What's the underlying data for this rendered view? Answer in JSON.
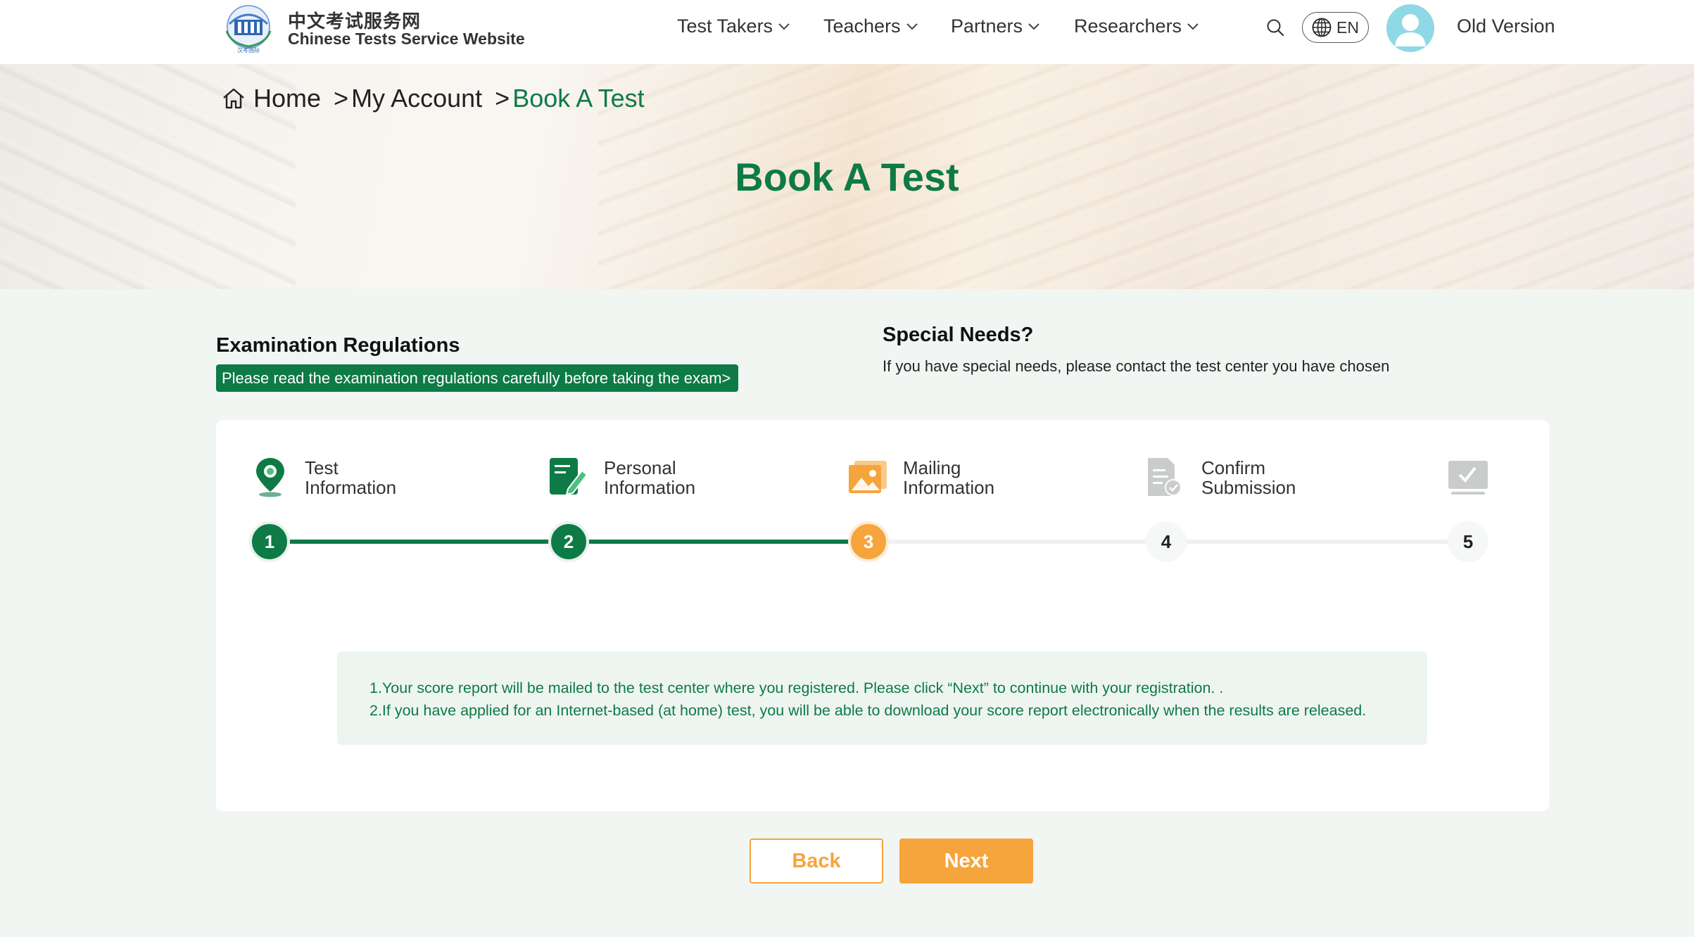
{
  "header": {
    "brand_cn": "中文考试服务网",
    "brand_en": "Chinese Tests Service Website",
    "logo_text": "汉考国际",
    "nav": [
      {
        "label": "Test Takers"
      },
      {
        "label": "Teachers"
      },
      {
        "label": "Partners"
      },
      {
        "label": "Researchers"
      }
    ],
    "language": "EN",
    "old_version": "Old Version"
  },
  "breadcrumb": {
    "home": "Home",
    "sep1": ">",
    "account": "My Account",
    "sep2": ">",
    "current": "Book A Test"
  },
  "page_title": "Book A Test",
  "regulations": {
    "title": "Examination Regulations",
    "link": "Please read the examination regulations carefully before taking the exam>"
  },
  "special_needs": {
    "title": "Special Needs?",
    "text": "If you have special needs, please contact the test center you have chosen"
  },
  "steps": [
    {
      "number": "1",
      "line1": "Test",
      "line2": "Information",
      "state": "done"
    },
    {
      "number": "2",
      "line1": "Personal",
      "line2": "Information",
      "state": "done"
    },
    {
      "number": "3",
      "line1": "Mailing",
      "line2": "Information",
      "state": "active"
    },
    {
      "number": "4",
      "line1": "Confirm",
      "line2": "Submission",
      "state": "todo"
    },
    {
      "number": "5",
      "line1": "",
      "line2": "",
      "state": "todo"
    }
  ],
  "notice": {
    "line1": "1.Your score report will be mailed to the test center where you registered. Please click “Next” to continue with your registration. .",
    "line2": "2.If you have applied for an Internet-based (at home) test, you will be able to download your score report electronically when the results are released."
  },
  "buttons": {
    "back": "Back",
    "next": "Next"
  },
  "colors": {
    "brand_green": "#0e7a46",
    "accent_orange": "#f6a43c",
    "page_bg": "#f1f6f3"
  }
}
